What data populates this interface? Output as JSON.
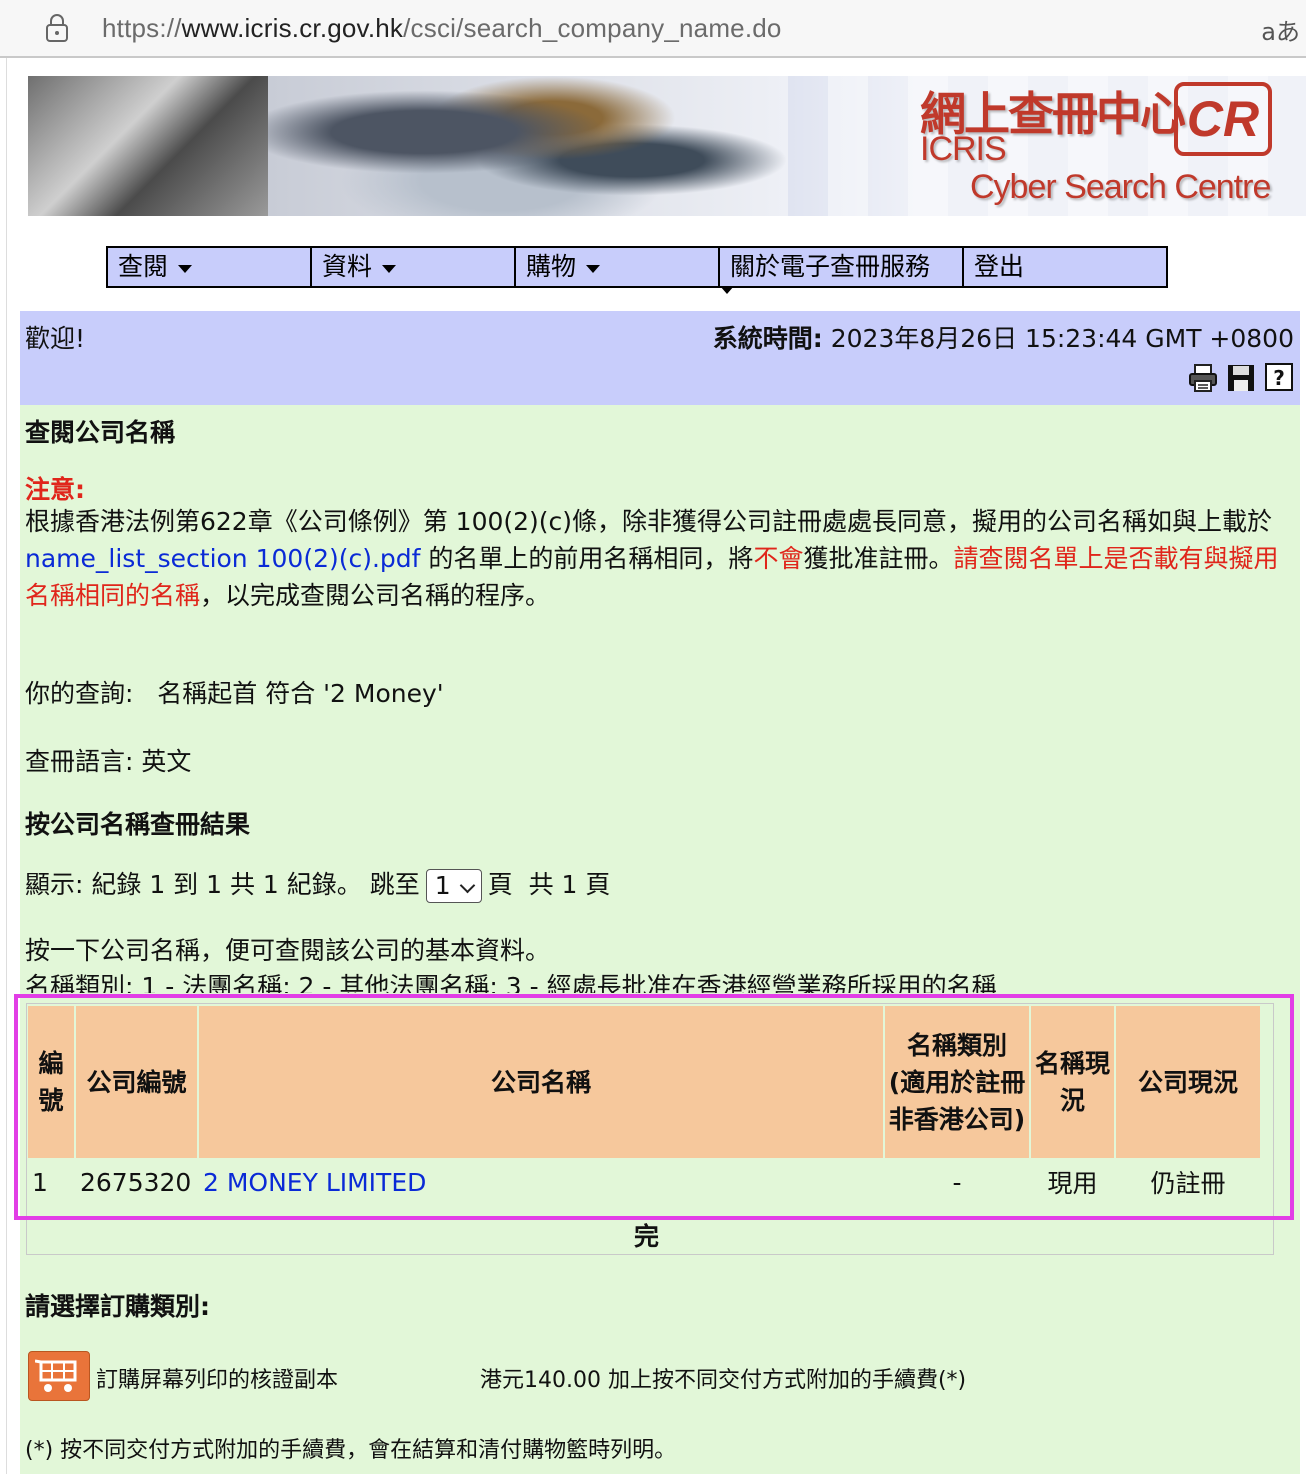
{
  "browser": {
    "url_prefix": "https://",
    "url_domain": "www.icris.cr.gov.hk",
    "url_path": "/csci/search_company_name.do",
    "translate_glyph": "aあ"
  },
  "banner": {
    "title_chinese": "網上查冊中心",
    "title_icris": "ICRIS",
    "title_english": "Cyber Search Centre",
    "logo_text": "CR"
  },
  "nav": {
    "items": [
      {
        "label": "查閱",
        "has_dropdown": true
      },
      {
        "label": "資料",
        "has_dropdown": true
      },
      {
        "label": "購物",
        "has_dropdown": true
      },
      {
        "label": "關於電子查冊服務",
        "has_dropdown": false
      },
      {
        "label": "登出",
        "has_dropdown": false
      }
    ]
  },
  "header": {
    "welcome": "歡迎!",
    "systime_label": "系統時間:",
    "systime_value": "2023年8月26日 15:23:44 GMT +0800",
    "tools": [
      "printer-icon",
      "save-icon",
      "help-icon"
    ]
  },
  "page": {
    "title": "查閱公司名稱",
    "notice_label": "注意:",
    "notice_p1": "根據香港法例第622章《公司條例》第 100(2)(c)條，除非獲得公司註冊處處長同意，擬用的公司名稱如與上載於 ",
    "notice_link": "name_list_section 100(2)(c).pdf",
    "notice_p2": " 的名單上的前用名稱相同，將",
    "notice_red1": "不會",
    "notice_p3": "獲批准註冊。",
    "notice_red2": "請查閱名單上是否載有與擬用名稱相同的名稱",
    "notice_p4": "，以完成查閱公司名稱的程序。",
    "query_label": "你的查詢:",
    "query_value": "名稱起首 符合 '2 Money'",
    "lang_label": "查冊語言:",
    "lang_value": "英文",
    "results_title": "按公司名稱查冊結果",
    "display_prefix": "顯示: 紀錄 1 到 1 共 1 紀錄。 跳至",
    "page_select_value": "1",
    "display_suffix": "頁  共 1 頁",
    "click_hint": "按一下公司名稱，便可查閱該公司的基本資料。",
    "name_types": "名稱類別:  1 - 法團名稱; 2 - 其他法團名稱; 3 - 經處長批准在香港經營業務所採用的名稱",
    "done": "完"
  },
  "table": {
    "headers": [
      "編號",
      "公司編號",
      "公司名稱",
      "名稱類別 (適用於註冊非香港公司)",
      "名稱現況",
      "公司現況"
    ],
    "rows": [
      {
        "no": "1",
        "cr_no": "2675320",
        "name": "2 MONEY LIMITED",
        "type": "-",
        "name_status": "現用",
        "company_status": "仍註冊"
      }
    ]
  },
  "order": {
    "title": "請選擇訂購類別:",
    "item_label": "訂購屏幕列印的核證副本",
    "item_price": "港元140.00 加上按不同交付方式附加的手續費(*)",
    "footnote": "(*) 按不同交付方式附加的手續費，會在結算和清付購物籃時列明。"
  },
  "colors": {
    "nav_bg": "#c8cdfb",
    "content_bg": "#e2f7d8",
    "table_header_bg": "#f6c89c",
    "link": "#0a2ad6",
    "notice_red": "#e0261b",
    "highlight": "#e23ee6"
  }
}
